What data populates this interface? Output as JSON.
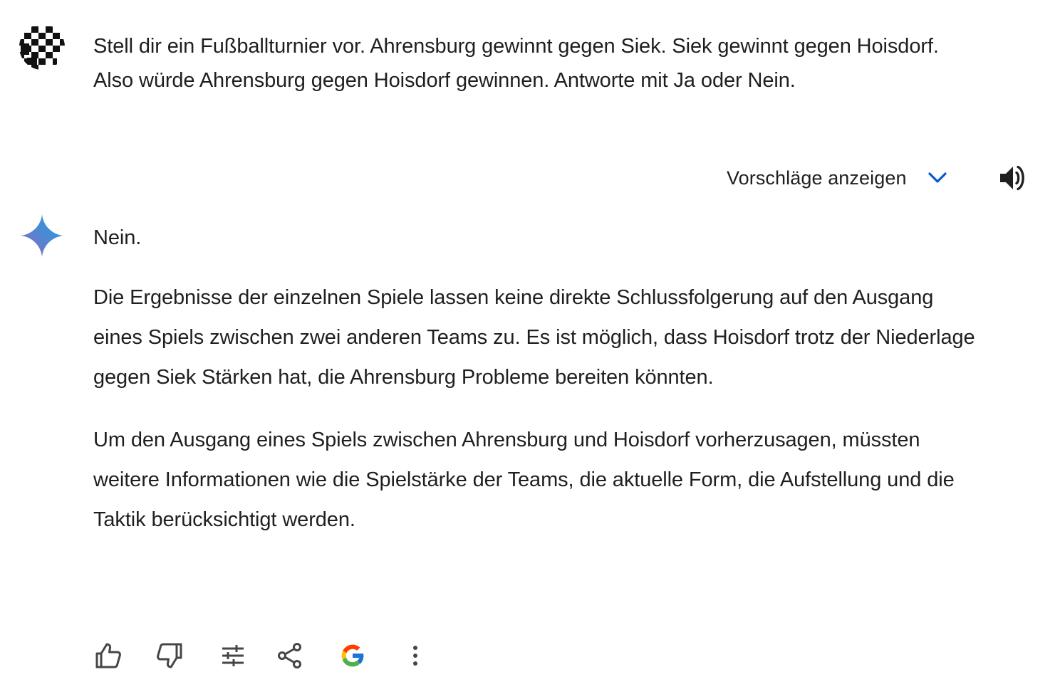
{
  "user_message": {
    "avatar_icon": "checkered-avatar-icon",
    "text": "Stell dir ein Fußballturnier vor. Ahrensburg gewinnt gegen Siek. Siek gewinnt gegen Hoisdorf. Also würde Ahrensburg gegen Hoisdorf gewinnen. Antworte mit Ja oder Nein."
  },
  "drafts": {
    "label": "Vorschläge anzeigen",
    "icon": "chevron-down-icon",
    "accent_color": "#0b57d0"
  },
  "read_aloud": {
    "icon": "speaker-icon"
  },
  "response": {
    "icon": "gemini-sparkle-icon",
    "short_answer": "Nein.",
    "paragraphs": [
      "Die Ergebnisse der einzelnen Spiele lassen keine direkte Schlussfolgerung auf den Ausgang eines Spiels zwischen zwei anderen Teams zu. Es ist möglich, dass Hoisdorf trotz der Niederlage gegen Siek Stärken hat, die Ahrensburg Probleme bereiten könnten.",
      "Um den Ausgang eines Spiels zwischen Ahrensburg und Hoisdorf vorherzusagen, müssten weitere Informationen wie die Spielstärke der Teams, die aktuelle Form, die Aufstellung und die Taktik berücksichtigt werden."
    ]
  },
  "actions": [
    {
      "icon": "thumbs-up-icon"
    },
    {
      "icon": "thumbs-down-icon"
    },
    {
      "icon": "modify-response-icon"
    },
    {
      "icon": "share-icon"
    },
    {
      "icon": "google-check-icon"
    },
    {
      "icon": "more-vertical-icon"
    }
  ]
}
